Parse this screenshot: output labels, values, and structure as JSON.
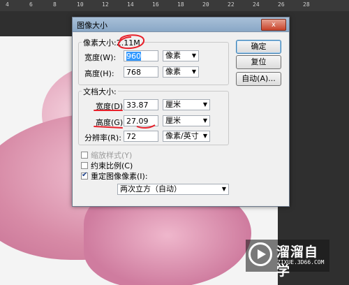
{
  "ruler": {
    "ticks": [
      "4",
      "6",
      "8",
      "10",
      "12",
      "14",
      "16",
      "18",
      "20",
      "22",
      "24",
      "26",
      "28"
    ]
  },
  "dialog": {
    "title": "图像大小",
    "close_label": "x",
    "pixel_dims": {
      "legend": "像素大小:2.11M",
      "width_label": "宽度(W):",
      "width_value": "960",
      "width_unit": "像素",
      "height_label": "高度(H):",
      "height_value": "768",
      "height_unit": "像素"
    },
    "doc_size": {
      "legend": "文档大小:",
      "width_label": "宽度(D):",
      "width_value": "33.87",
      "width_unit": "厘米",
      "height_label": "高度(G):",
      "height_value": "27.09",
      "height_unit": "厘米",
      "res_label": "分辨率(R):",
      "res_value": "72",
      "res_unit": "像素/英寸"
    },
    "options": {
      "scale_styles": "缩放样式(Y)",
      "constrain": "约束比例(C)",
      "resample": "重定图像像素(I):",
      "resample_method": "两次立方（自动）"
    },
    "buttons": {
      "ok": "确定",
      "reset": "复位",
      "auto": "自动(A)..."
    }
  },
  "watermark": {
    "brand": "溜溜自学",
    "url": "ZIXUE.3D66.COM"
  },
  "colors": {
    "accent_red": "#e8202a",
    "selection": "#3399ff"
  }
}
